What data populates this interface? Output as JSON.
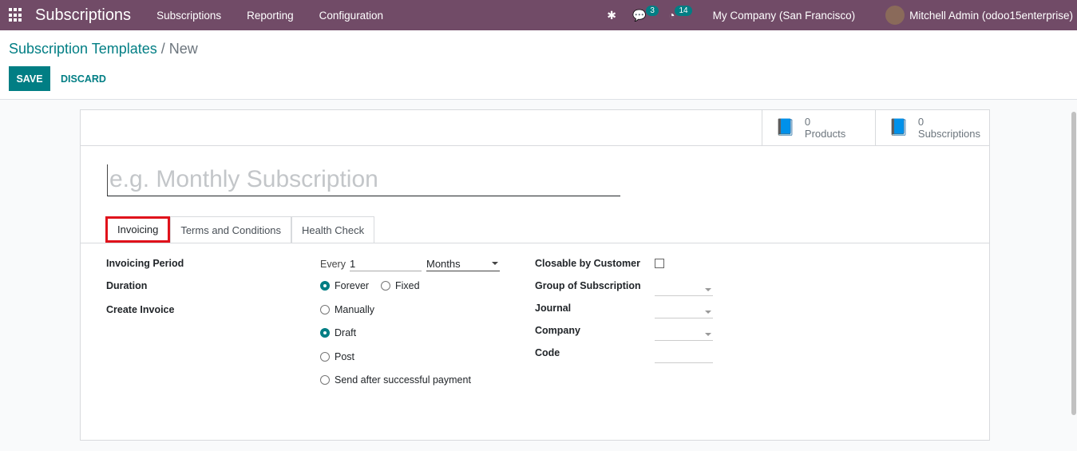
{
  "nav": {
    "app": "Subscriptions",
    "menus": [
      "Subscriptions",
      "Reporting",
      "Configuration"
    ],
    "messages_count": "3",
    "activities_count": "14",
    "company": "My Company (San Francisco)",
    "user": "Mitchell Admin (odoo15enterprise)"
  },
  "breadcrumb": {
    "parent": "Subscription Templates",
    "current": "/ New"
  },
  "actions": {
    "save": "SAVE",
    "discard": "DISCARD"
  },
  "buttons": [
    {
      "count": "0",
      "label": "Products"
    },
    {
      "count": "0",
      "label": "Subscriptions"
    }
  ],
  "form": {
    "name_placeholder": "e.g. Monthly Subscription",
    "tabs": [
      "Invoicing",
      "Terms and Conditions",
      "Health Check"
    ],
    "invoicing_period_label": "Invoicing Period",
    "every": "Every",
    "every_value": "1",
    "period_unit": "Months",
    "duration_label": "Duration",
    "duration_options": [
      "Forever",
      "Fixed"
    ],
    "duration_selected": "Forever",
    "create_invoice_label": "Create Invoice",
    "create_invoice_options": [
      "Manually",
      "Draft",
      "Post",
      "Send after successful payment"
    ],
    "create_invoice_selected": "Draft",
    "closable_label": "Closable by Customer",
    "closable_checked": false,
    "group_label": "Group of Subscription",
    "journal_label": "Journal",
    "company_label": "Company",
    "code_label": "Code"
  }
}
